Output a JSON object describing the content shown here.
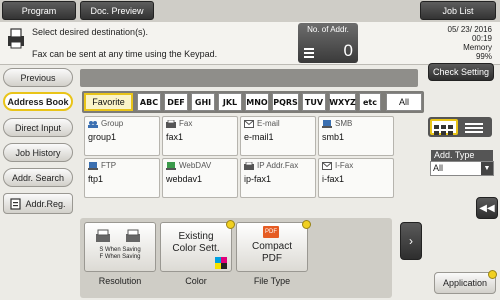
{
  "topbar": {
    "program_label": "Program",
    "doc_preview_label": "Doc. Preview",
    "job_list_label": "Job List"
  },
  "header": {
    "message_line1": "Select desired destination(s).",
    "message_line2": "Fax can be sent at any time using the Keypad.",
    "addr_count_label": "No. of Addr.",
    "addr_count_value": "0",
    "date": "05/ 23/ 2016",
    "time": "00:19",
    "memory_label": "Memory",
    "memory_value": "99%"
  },
  "nav": {
    "previous": "Previous",
    "address_book": "Address Book",
    "direct_input": "Direct Input",
    "job_history": "Job History",
    "addr_search": "Addr. Search",
    "addr_reg": "Addr.Reg."
  },
  "check_setting": "Check Setting",
  "index_tabs": {
    "favorite": "Favorite",
    "letters": [
      "ABC",
      "DEF",
      "GHI",
      "JKL",
      "MNO",
      "PQRS",
      "TUV",
      "WXYZ",
      "etc"
    ],
    "all": "All"
  },
  "destinations": [
    {
      "type": "Group",
      "name": "group1",
      "icon": "group-icon"
    },
    {
      "type": "Fax",
      "name": "fax1",
      "icon": "fax-icon"
    },
    {
      "type": "E-mail",
      "name": "e-mail1",
      "icon": "email-icon"
    },
    {
      "type": "SMB",
      "name": "smb1",
      "icon": "smb-icon"
    },
    {
      "type": "FTP",
      "name": "ftp1",
      "icon": "ftp-icon"
    },
    {
      "type": "WebDAV",
      "name": "webdav1",
      "icon": "webdav-icon"
    },
    {
      "type": "IP Addr.Fax",
      "name": "ip-fax1",
      "icon": "ip-fax-icon"
    },
    {
      "type": "I-Fax",
      "name": "i-fax1",
      "icon": "i-fax-icon"
    }
  ],
  "add_type": {
    "label": "Add. Type",
    "value": "All"
  },
  "settings": {
    "resolution_icon_text1": "S When Saving",
    "resolution_icon_text2": "F When Saving",
    "resolution_label": "Resolution",
    "color_button": "Existing Color Sett.",
    "color_label": "Color",
    "file_type_button": "Compact PDF",
    "file_type_label": "File Type",
    "pdf_badge": "PDF"
  },
  "application_label": "Application",
  "colors": {
    "accent_yellow": "#e9c418",
    "dark_button": "#333333"
  }
}
